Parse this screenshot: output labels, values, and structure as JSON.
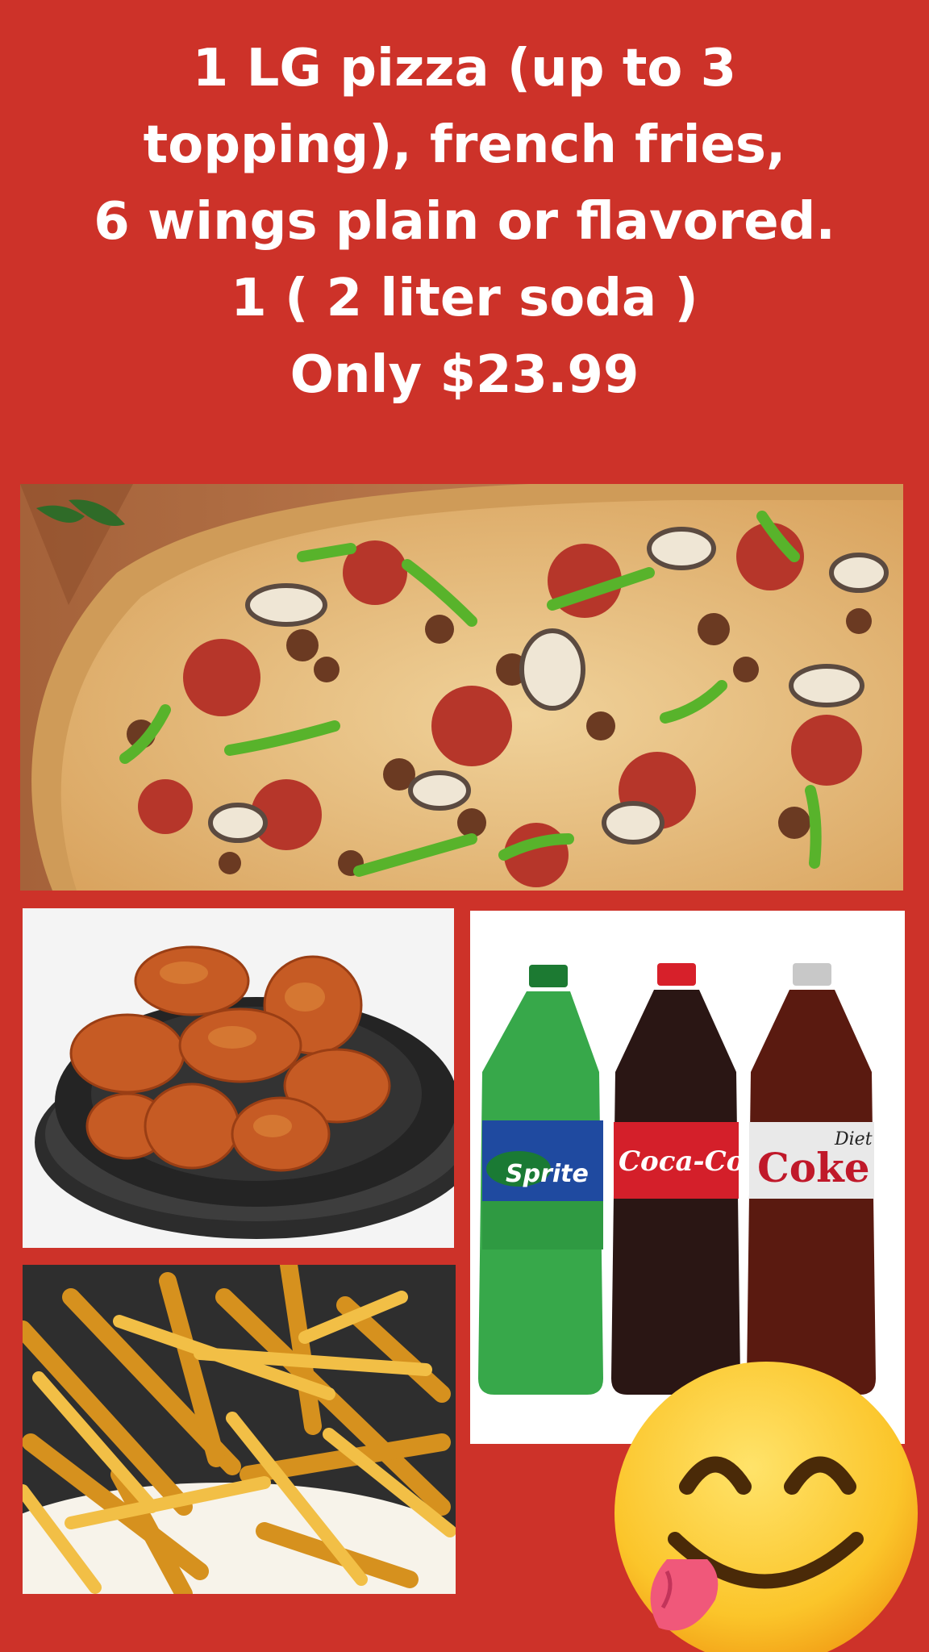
{
  "headline": {
    "lines": [
      "1 LG pizza (up to 3",
      "topping), french fries,",
      "6 wings plain or flavored.",
      "1 ( 2 liter soda )",
      "Only $23.99"
    ]
  },
  "images": {
    "pizza": "supreme-pizza-photo",
    "wings": "chicken-wings-photo",
    "sodas": "soda-bottles-photo",
    "fries": "french-fries-photo",
    "emoji": "yum-face-emoji"
  },
  "soda_labels": {
    "sprite": "Sprite",
    "coca_cola": "Coca-Cola",
    "diet_coke_small": "Diet",
    "diet_coke": "Coke"
  },
  "colors": {
    "background": "#cd3229",
    "text": "#ffffff"
  }
}
